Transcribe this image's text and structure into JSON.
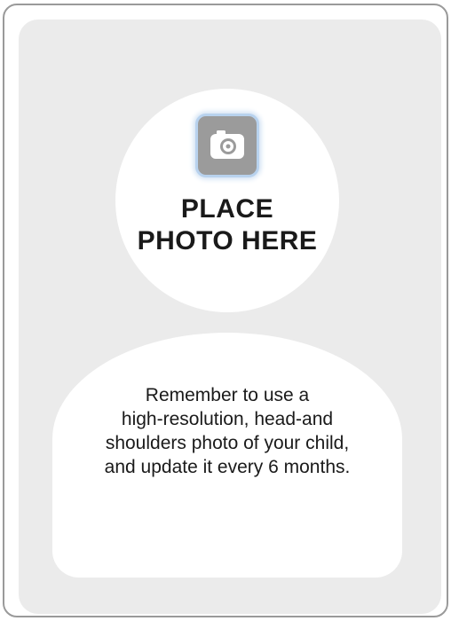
{
  "placeholder": {
    "icon": "camera-icon",
    "heading_lines": [
      "PLACE",
      "PHOTO HERE"
    ]
  },
  "note": {
    "lines": [
      "Remember to use a",
      "high-resolution, head-and",
      "shoulders photo of your child,",
      "and update it every 6 months."
    ]
  },
  "colors": {
    "panel": "#ebebeb",
    "frame_border": "#9a9a9a",
    "icon_background": "#9b9b9b",
    "icon_glow": "#b8d2ee",
    "text": "#1a1a1a"
  }
}
